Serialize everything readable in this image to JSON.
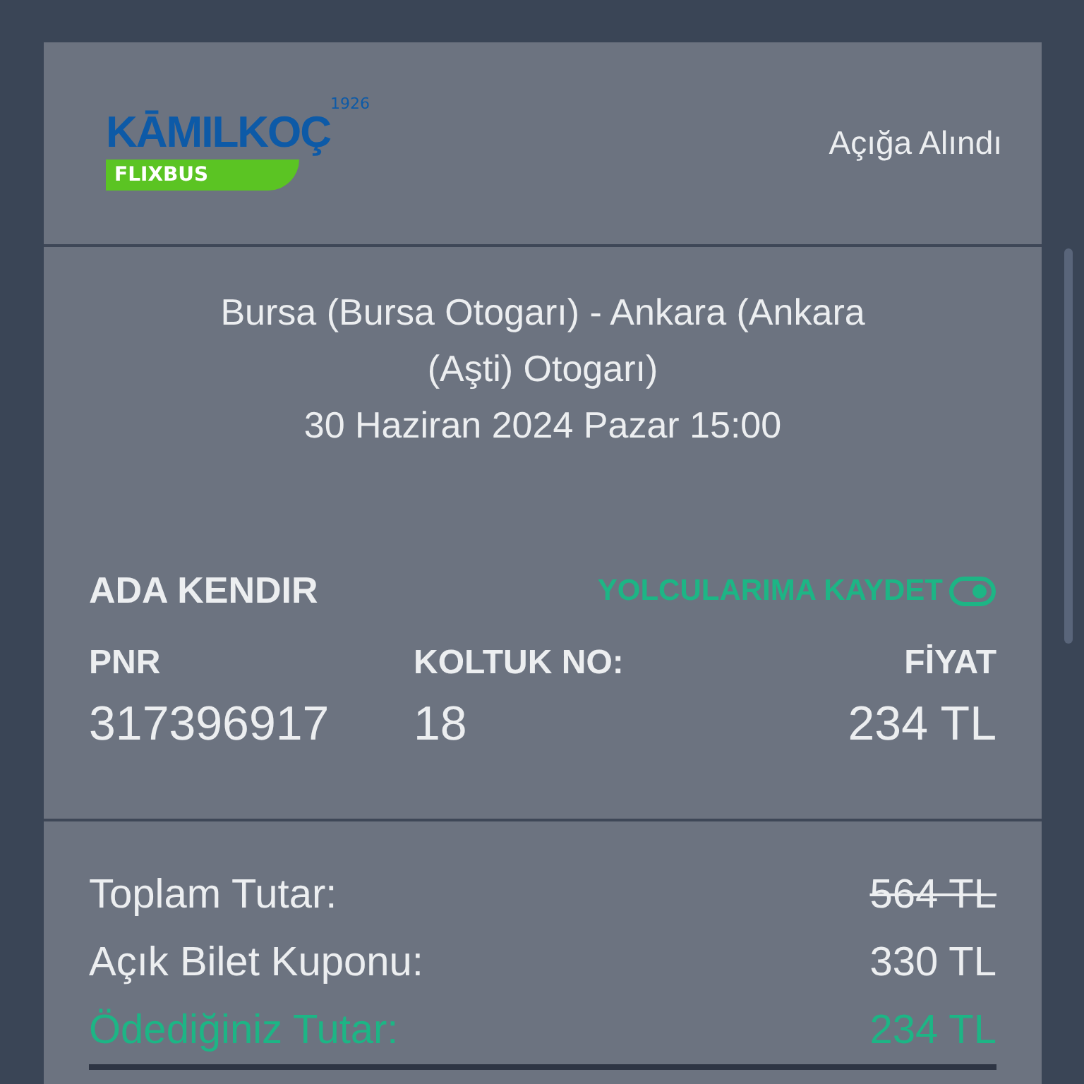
{
  "header": {
    "logo": {
      "brand": "KĀMILKOÇ",
      "year": "1926",
      "sub_brand": "FLIXBUS"
    },
    "status": "Açığa Alındı"
  },
  "trip": {
    "route": "Bursa (Bursa Otogarı) - Ankara (Ankara (Aşti) Otogarı)",
    "datetime": "30 Haziran 2024 Pazar 15:00"
  },
  "passenger": {
    "name": "ADA KENDIR",
    "save_link": "YOLCULARIMA KAYDET",
    "save_toggle_on": true,
    "fields": [
      {
        "label": "PNR",
        "value": "317396917"
      },
      {
        "label": "KOLTUK NO:",
        "value": "18"
      },
      {
        "label": "FİYAT",
        "value": "234 TL"
      }
    ]
  },
  "totals": [
    {
      "kind": "struck",
      "label": "Toplam Tutar:",
      "value": "564 TL"
    },
    {
      "kind": "plain",
      "label": "Açık Bilet Kuponu:",
      "value": "330 TL"
    },
    {
      "kind": "paid",
      "label": "Ödediğiniz Tutar:",
      "value": "234 TL"
    }
  ]
}
